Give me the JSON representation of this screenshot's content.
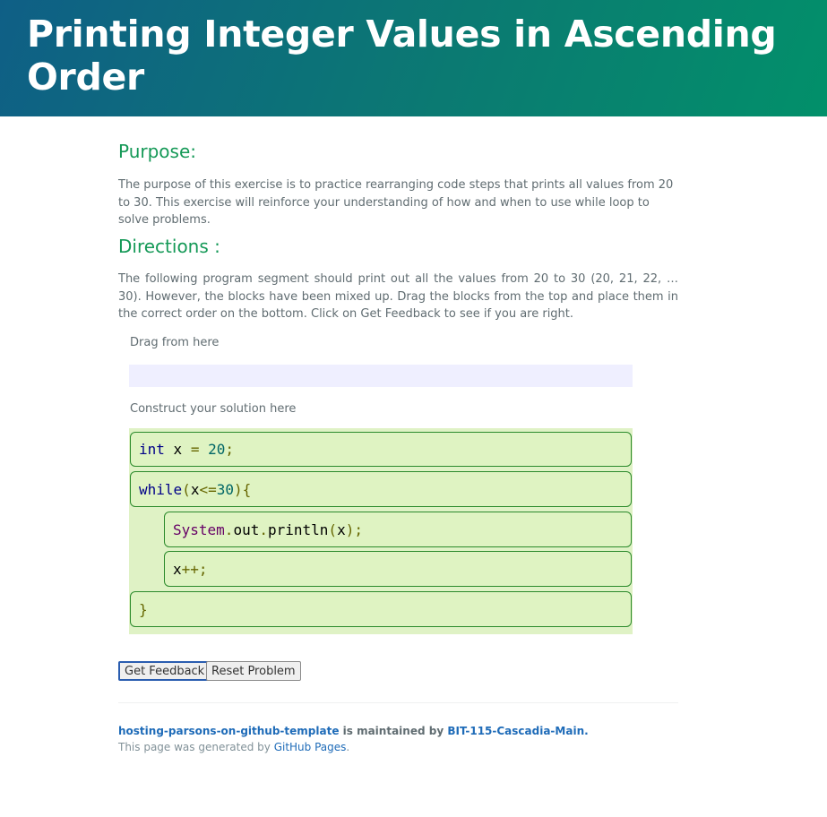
{
  "header": {
    "title": "Printing Integer Values in Ascending Order"
  },
  "purpose": {
    "heading": "Purpose:",
    "text": "The purpose of this exercise is to practice rearranging code steps that prints all values from 20 to 30. This exercise will reinforce your understanding of how and when to use while loop to solve problems."
  },
  "directions": {
    "heading": "Directions :",
    "text": "The following program segment should print out all the values from 20 to 30 (20, 21, 22, … 30). However, the blocks have been mixed up. Drag the blocks from the top and place them in the correct order on the bottom. Click on Get Feedback to see if you are right."
  },
  "parsons": {
    "drag_label": "Drag from here",
    "solution_label": "Construct your solution here",
    "blocks": {
      "b1": {
        "kw": "int",
        "var": " x ",
        "op": "=",
        "num": " 20",
        "end": ";"
      },
      "b2": {
        "kw": "while",
        "open": "(",
        "var": "x",
        "op": "<=",
        "num": "30",
        "close": "){"
      },
      "b3": {
        "typ": "System",
        "dot1": ".",
        "out": "out",
        "dot2": ".",
        "fn": "println",
        "open": "(",
        "var": "x",
        "close": ");"
      },
      "b4": {
        "var": "x",
        "op": "++;"
      },
      "b5": {
        "close": "}"
      }
    }
  },
  "buttons": {
    "feedback": "Get Feedback",
    "reset": "Reset Problem"
  },
  "footer": {
    "repo_link": "hosting-parsons-on-github-template",
    "maintained_text": " is maintained by ",
    "owner_link": "BIT-115-Cascadia-Main",
    "period": ".",
    "generated_text": "This page was generated by ",
    "pages_link": "GitHub Pages",
    "period2": "."
  },
  "colors": {
    "accent": "#159957",
    "header_start": "#0f5f86",
    "header_end": "#02906a",
    "block_bg": "#dff3c2",
    "block_border": "#2b8a2b",
    "source_bg": "#efefff"
  }
}
